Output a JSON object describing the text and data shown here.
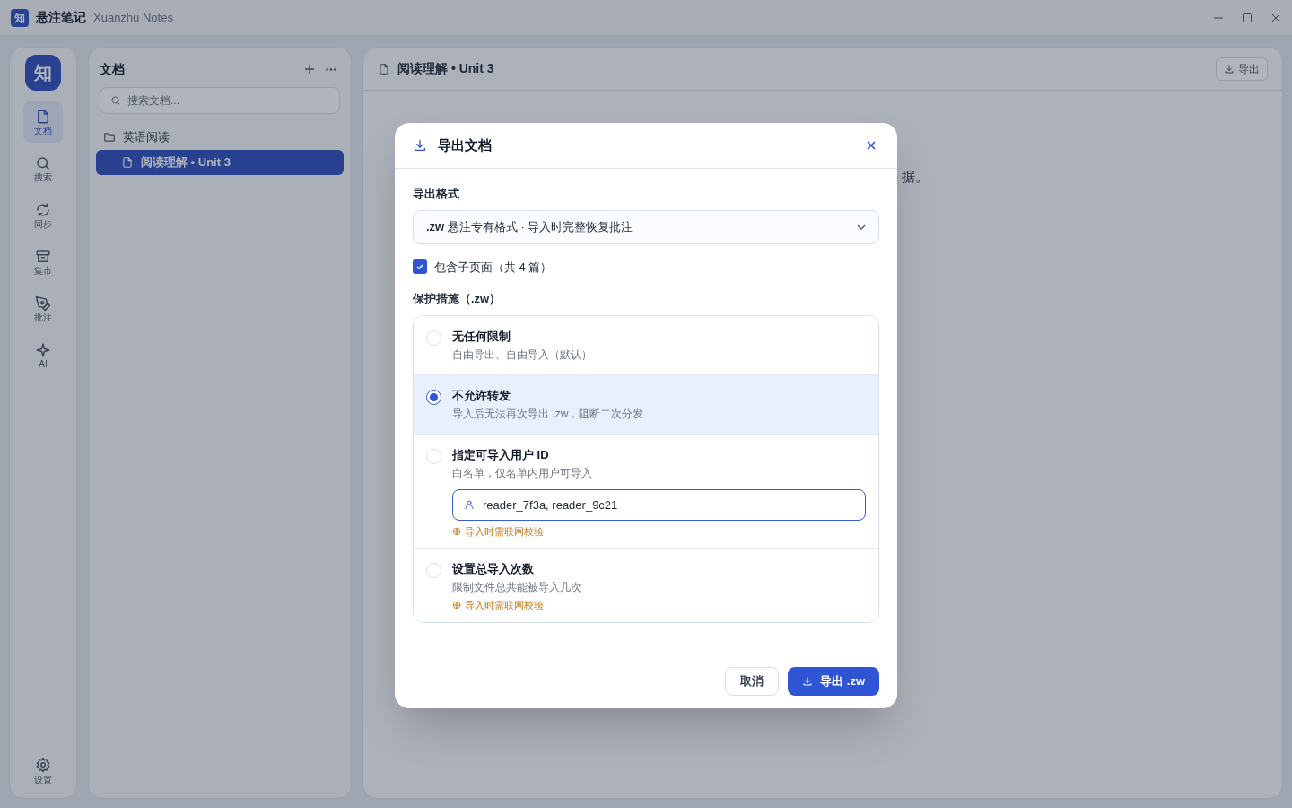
{
  "window": {
    "logo": "知",
    "title": "悬注笔记",
    "subtitle": "Xuanzhu Notes"
  },
  "rail": {
    "logo": "知",
    "items": [
      {
        "kind": "file",
        "label": "文档",
        "selected": true
      },
      {
        "kind": "search",
        "label": "搜索",
        "selected": false
      },
      {
        "kind": "sync",
        "label": "同步",
        "selected": false
      },
      {
        "kind": "market",
        "label": "集市",
        "selected": false
      },
      {
        "kind": "pen",
        "label": "批注",
        "selected": false
      },
      {
        "kind": "sparkle",
        "label": "AI",
        "selected": false
      }
    ],
    "settings": "设置"
  },
  "docs": {
    "title": "文档",
    "search_placeholder": "搜索文档...",
    "tree": [
      {
        "label": "英语阅读",
        "kind": "folder",
        "selected": false,
        "children": [
          {
            "label": "阅读理解 • Unit 3",
            "kind": "file",
            "selected": true
          }
        ]
      }
    ]
  },
  "editor": {
    "breadcrumb": "阅读理解 • Unit 3",
    "export_button": "导出",
    "para_end": "据。"
  },
  "dialog": {
    "title": "导出文档",
    "format_label": "导出格式",
    "format_value_bold": ".zw",
    "format_value": "悬注专有格式 · 导入时完整恢复批注",
    "include_children": {
      "label": "包含子页面（共 4 篇）",
      "checked": true
    },
    "protection_label": "保护措施（.zw）",
    "options": [
      {
        "title": "无任何限制",
        "desc": "自由导出、自由导入（默认）",
        "selected": false
      },
      {
        "title": "不允许转发",
        "desc": "导入后无法再次导出 .zw，阻断二次分发",
        "selected": true
      },
      {
        "title": "指定可导入用户 ID",
        "desc": "白名单，仅名单内用户可导入",
        "selected": false,
        "input_value": "reader_7f3a, reader_9c21",
        "note": "导入时需联网校验"
      },
      {
        "title": "设置总导入次数",
        "desc": "限制文件总共能被导入几次",
        "selected": false,
        "note": "导入时需联网校验"
      }
    ],
    "cancel": "取消",
    "confirm": "导出 .zw"
  }
}
